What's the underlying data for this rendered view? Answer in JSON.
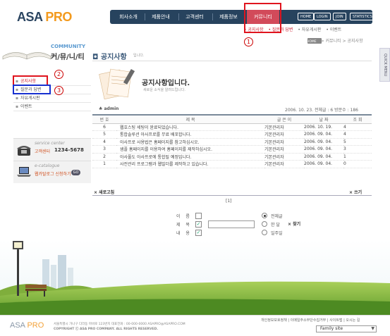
{
  "header": {
    "logo_main": "ASA",
    "logo_accent": " PRO",
    "nav": [
      "회사소개",
      "제품안내",
      "고객센터",
      "제품정보",
      "커뮤니티"
    ],
    "utility": [
      "HOME",
      "LOGIN",
      "JOIN",
      "STATISTICS"
    ],
    "subnav": [
      "• 공지사항",
      "• 질문과 답변",
      "• 자유게시판",
      "• 이벤트"
    ]
  },
  "annotations": {
    "n1": "1",
    "n2": "2",
    "n3": "3"
  },
  "sidebar": {
    "title_en": "COMMUNITY",
    "title_ko": "커/뮤/니/티",
    "items": [
      "공지사항",
      "질문과 답변",
      "자유게시판",
      "이벤트"
    ],
    "service_title": "service center",
    "service_label": "고객센터",
    "service_number": "1234-5678",
    "catalogue_title": "e-catalogue",
    "catalogue_label": "웹카탈로그 신청하기",
    "go": "GO"
  },
  "main": {
    "title": "공지사항",
    "title_sub": "입니다.",
    "breadcrumb": "> 커뮤니티 > 공지사항",
    "home": "HOME",
    "hero_title": "공지사항입니다.",
    "hero_sub": "새로운 소식을 알려드립니다.",
    "author": "admin",
    "meta": "2006. 10. 23. 전체글 : 6  방문수 : 186",
    "quick_menu": "QUICK MENU"
  },
  "table": {
    "headers": [
      "번 호",
      "제   목",
      "글 쓴 이",
      "날  짜",
      "조 회"
    ],
    "rows": [
      {
        "no": "6",
        "title": "웹호스팅 세팅이 완료되었습니다.",
        "writer": "기본관리자",
        "date": "2006. 10. 19.",
        "views": "4"
      },
      {
        "no": "5",
        "title": "통합솔루션 아사프로를 무료 배포합니다.",
        "writer": "기본관리자",
        "date": "2006. 09. 04.",
        "views": "4"
      },
      {
        "no": "4",
        "title": "아사프로 사용법은 홈페이지를 참고하십시오.",
        "writer": "기본관리자",
        "date": "2006. 09. 04.",
        "views": "5"
      },
      {
        "no": "3",
        "title": "샘플 홈페이지를 이용하여 홈페이지를 제작하십시오.",
        "writer": "기본관리자",
        "date": "2006. 09. 04.",
        "views": "3"
      },
      {
        "no": "2",
        "title": "아사풀도 아사프로에 통합될 예정입니다.",
        "writer": "기본관리자",
        "date": "2006. 09. 04.",
        "views": "1"
      },
      {
        "no": "1",
        "title": "사전관리 프로그램과 웹빌더를 제작하고 있습니다.",
        "writer": "기본관리자",
        "date": "2006. 09. 04.",
        "views": "0"
      }
    ],
    "refresh": "× 새로고침",
    "write": "× 쓰기",
    "page": "[1]"
  },
  "search": {
    "labels": [
      "이 름",
      "제 목",
      "내 용"
    ],
    "checks": [
      "",
      "✓",
      "✓"
    ],
    "periods": [
      "전체글",
      "한  달",
      "일주일"
    ],
    "button": "찾기"
  },
  "footer": {
    "logo_main": "ASA",
    "logo_accent": " PRO",
    "address": "서울특별시 가나구 다라동 마바로 123번지  대표전화 : 00-000-0000  ASAPRO@ASAPRO.COM",
    "copyright": "COPYRIGHT ⓒ ASA PRO COMPANY. ALL RIGHTS RESERVED.",
    "links": "개인정보보호정책  |  이메일주소무단수집거부  |  사이트맵  |  오시는 길",
    "family_site": "Family site"
  }
}
